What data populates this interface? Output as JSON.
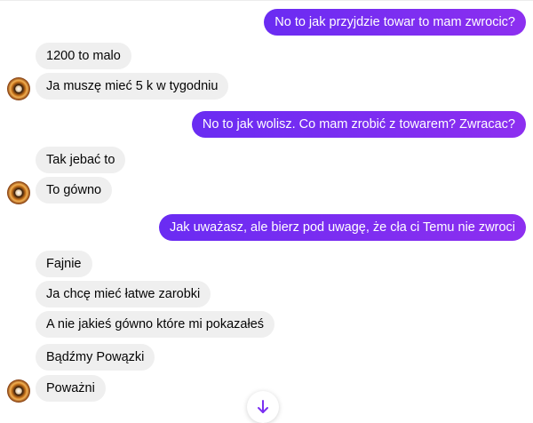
{
  "messages": [
    {
      "side": "out",
      "text": "No to jak przyjdzie towar to mam zwrocic?"
    },
    {
      "side": "in",
      "text": "1200 to malo"
    },
    {
      "side": "in",
      "text": "Ja muszę mieć 5 k w tygodniu"
    },
    {
      "side": "out",
      "text": "No to jak wolisz. Co mam zrobić z towarem? Zwracac?"
    },
    {
      "side": "in",
      "text": "Tak jebać to"
    },
    {
      "side": "in",
      "text": "To gówno"
    },
    {
      "side": "out",
      "text": "Jak uważasz, ale bierz pod uwagę, że cła ci Temu nie zwroci"
    },
    {
      "side": "in",
      "text": "Fajnie"
    },
    {
      "side": "in",
      "text": "Ja chcę mieć łatwe zarobki"
    },
    {
      "side": "in",
      "text": "A nie jakieś gówno które mi pokazałeś"
    },
    {
      "side": "in",
      "text": "Bądźmy Powązki"
    },
    {
      "side": "in",
      "text": "Poważni"
    }
  ],
  "icons": {
    "avatar": "contact-avatar",
    "scroll": "arrow-down-icon"
  },
  "colors": {
    "outgoing_start": "#6a2cf2",
    "outgoing_end": "#8d2ff0",
    "incoming": "#efefef",
    "background": "#ffffff"
  }
}
